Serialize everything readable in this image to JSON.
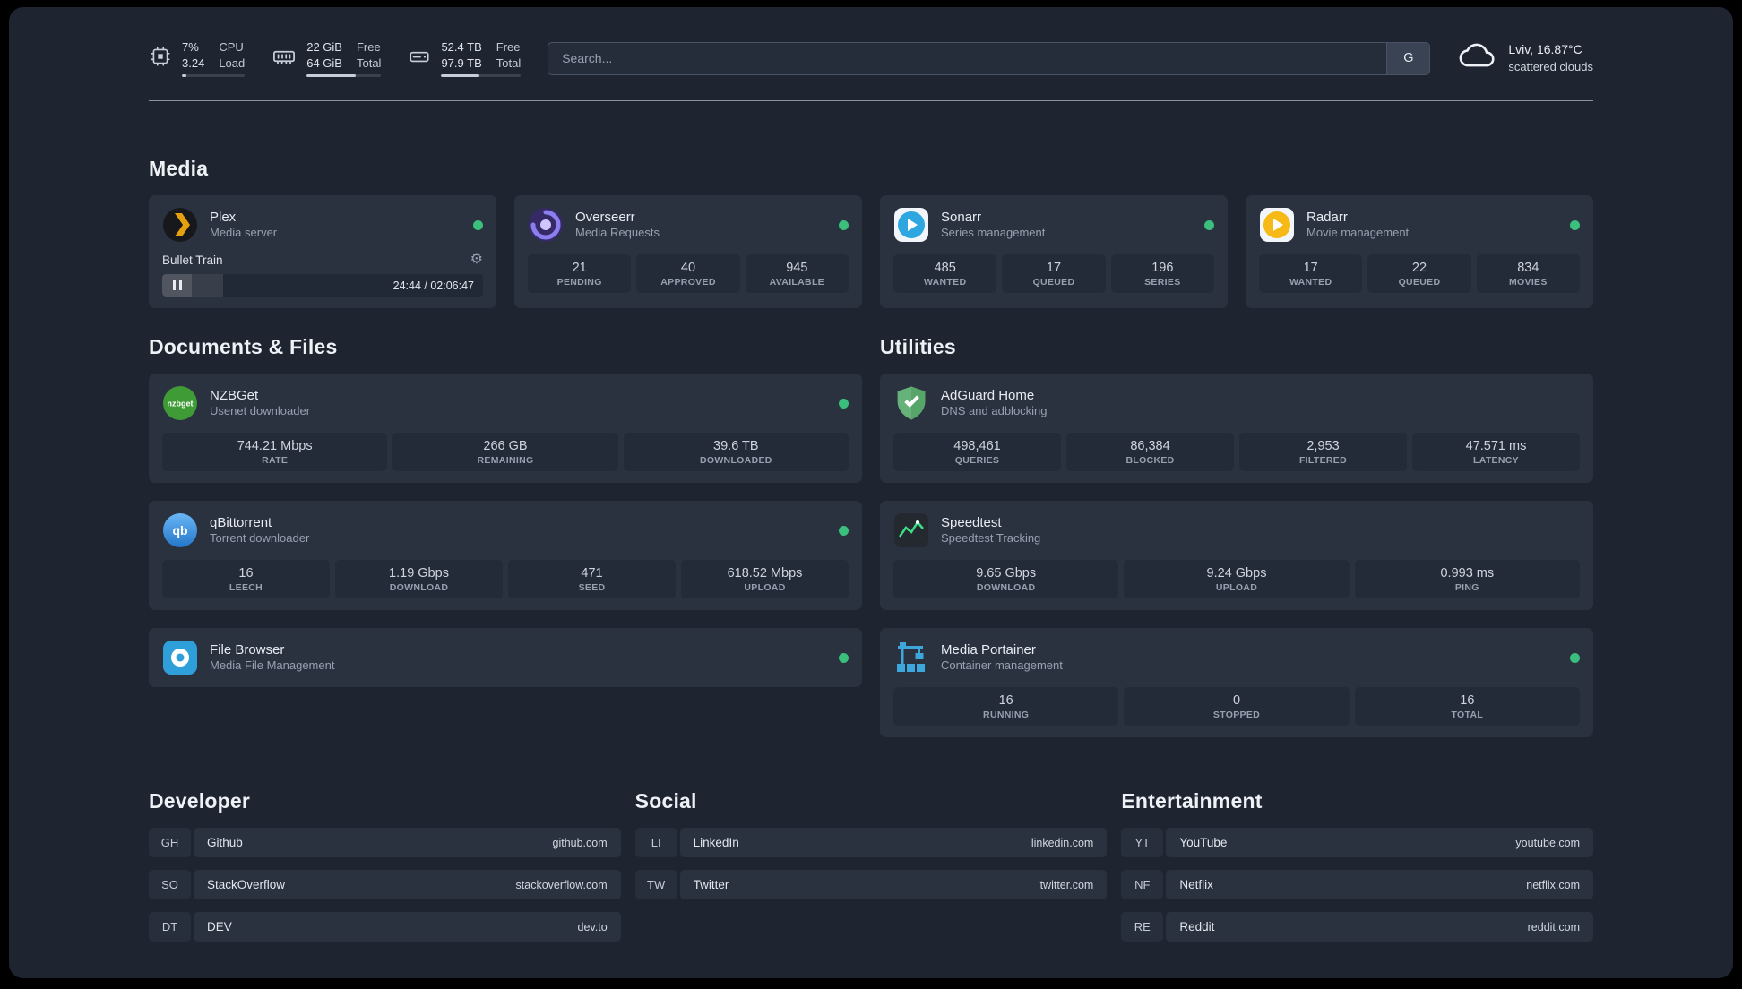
{
  "topbar": {
    "resources": [
      {
        "id": "cpu",
        "icon": "cpu-icon",
        "value_top": "7%",
        "label_top": "CPU",
        "value_bottom": "3.24",
        "label_bottom": "Load",
        "progress": 7
      },
      {
        "id": "memory",
        "icon": "memory-icon",
        "value_top": "22 GiB",
        "label_top": "Free",
        "value_bottom": "64 GiB",
        "label_bottom": "Total",
        "progress": 66
      },
      {
        "id": "disk",
        "icon": "disk-icon",
        "value_top": "52.4 TB",
        "label_top": "Free",
        "value_bottom": "97.9 TB",
        "label_bottom": "Total",
        "progress": 47
      }
    ],
    "search": {
      "placeholder": "Search...",
      "provider_label": "G"
    },
    "weather": {
      "icon": "cloud-icon",
      "location": "Lviv, 16.87°C",
      "condition": "scattered clouds"
    }
  },
  "colors": {
    "status_online": "#3bbf7d",
    "accent_plex": "#e5a00d",
    "accent_green_line": "#3ddc84"
  },
  "sections": {
    "media": {
      "title": "Media",
      "plex": {
        "name": "Plex",
        "subtitle": "Media server",
        "icon": "plex-icon",
        "status": "online",
        "now_playing": "Bullet Train",
        "time": "24:44 / 02:06:47",
        "progress": 19
      },
      "overseerr": {
        "name": "Overseerr",
        "subtitle": "Media Requests",
        "icon": "overseerr-icon",
        "status": "online",
        "stats": [
          {
            "value": "21",
            "label": "PENDING"
          },
          {
            "value": "40",
            "label": "APPROVED"
          },
          {
            "value": "945",
            "label": "AVAILABLE"
          }
        ]
      },
      "sonarr": {
        "name": "Sonarr",
        "subtitle": "Series management",
        "icon": "sonarr-icon",
        "status": "online",
        "stats": [
          {
            "value": "485",
            "label": "WANTED"
          },
          {
            "value": "17",
            "label": "QUEUED"
          },
          {
            "value": "196",
            "label": "SERIES"
          }
        ]
      },
      "radarr": {
        "name": "Radarr",
        "subtitle": "Movie management",
        "icon": "radarr-icon",
        "status": "online",
        "stats": [
          {
            "value": "17",
            "label": "WANTED"
          },
          {
            "value": "22",
            "label": "QUEUED"
          },
          {
            "value": "834",
            "label": "MOVIES"
          }
        ]
      }
    },
    "documents": {
      "title": "Documents & Files",
      "nzbget": {
        "name": "NZBGet",
        "subtitle": "Usenet downloader",
        "icon": "nzbget-icon",
        "status": "online",
        "stats": [
          {
            "value": "744.21 Mbps",
            "label": "RATE"
          },
          {
            "value": "266 GB",
            "label": "REMAINING"
          },
          {
            "value": "39.6 TB",
            "label": "DOWNLOADED"
          }
        ]
      },
      "qbittorrent": {
        "name": "qBittorrent",
        "subtitle": "Torrent downloader",
        "icon": "qbittorrent-icon",
        "status": "online",
        "stats": [
          {
            "value": "16",
            "label": "LEECH"
          },
          {
            "value": "1.19 Gbps",
            "label": "DOWNLOAD"
          },
          {
            "value": "471",
            "label": "SEED"
          },
          {
            "value": "618.52 Mbps",
            "label": "UPLOAD"
          }
        ]
      },
      "filebrowser": {
        "name": "File Browser",
        "subtitle": "Media File Management",
        "icon": "filebrowser-icon",
        "status": "online"
      }
    },
    "utilities": {
      "title": "Utilities",
      "adguard": {
        "name": "AdGuard Home",
        "subtitle": "DNS and adblocking",
        "icon": "adguard-icon",
        "stats": [
          {
            "value": "498,461",
            "label": "QUERIES"
          },
          {
            "value": "86,384",
            "label": "BLOCKED"
          },
          {
            "value": "2,953",
            "label": "FILTERED"
          },
          {
            "value": "47.571 ms",
            "label": "LATENCY"
          }
        ]
      },
      "speedtest": {
        "name": "Speedtest",
        "subtitle": "Speedtest Tracking",
        "icon": "speedtest-icon",
        "stats": [
          {
            "value": "9.65 Gbps",
            "label": "DOWNLOAD"
          },
          {
            "value": "9.24 Gbps",
            "label": "UPLOAD"
          },
          {
            "value": "0.993 ms",
            "label": "PING"
          }
        ]
      },
      "portainer": {
        "name": "Media Portainer",
        "subtitle": "Container management",
        "icon": "portainer-icon",
        "status": "online",
        "stats": [
          {
            "value": "16",
            "label": "RUNNING"
          },
          {
            "value": "0",
            "label": "STOPPED"
          },
          {
            "value": "16",
            "label": "TOTAL"
          }
        ]
      }
    },
    "bookmarks": {
      "developer": {
        "title": "Developer",
        "items": [
          {
            "abbr": "GH",
            "name": "Github",
            "url": "github.com"
          },
          {
            "abbr": "SO",
            "name": "StackOverflow",
            "url": "stackoverflow.com"
          },
          {
            "abbr": "DT",
            "name": "DEV",
            "url": "dev.to"
          }
        ]
      },
      "social": {
        "title": "Social",
        "items": [
          {
            "abbr": "LI",
            "name": "LinkedIn",
            "url": "linkedin.com"
          },
          {
            "abbr": "TW",
            "name": "Twitter",
            "url": "twitter.com"
          }
        ]
      },
      "entertainment": {
        "title": "Entertainment",
        "items": [
          {
            "abbr": "YT",
            "name": "YouTube",
            "url": "youtube.com"
          },
          {
            "abbr": "NF",
            "name": "Netflix",
            "url": "netflix.com"
          },
          {
            "abbr": "RE",
            "name": "Reddit",
            "url": "reddit.com"
          }
        ]
      }
    }
  }
}
